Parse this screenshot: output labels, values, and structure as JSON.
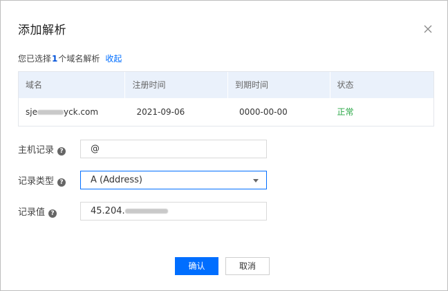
{
  "dialog": {
    "title": "添加解析",
    "close_icon": "close-icon"
  },
  "summary": {
    "prefix": "您已选择",
    "count": "1",
    "suffix": "个域名解析",
    "collapse_link": "收起"
  },
  "table": {
    "headers": [
      "域名",
      "注册时间",
      "到期时间",
      "状态"
    ],
    "rows": [
      {
        "domain_prefix": "sje",
        "domain_suffix": "yck.com",
        "registered": "2021-09-06",
        "expires": "0000-00-00",
        "status": "正常"
      }
    ]
  },
  "form": {
    "host_record": {
      "label": "主机记录",
      "value": "@"
    },
    "record_type": {
      "label": "记录类型",
      "value": "A (Address)"
    },
    "record_value": {
      "label": "记录值",
      "value_prefix": "45.204."
    }
  },
  "buttons": {
    "confirm": "确认",
    "cancel": "取消"
  },
  "colors": {
    "primary": "#006eff",
    "status_ok": "#29a745",
    "table_header_bg": "#eaf1fb"
  }
}
